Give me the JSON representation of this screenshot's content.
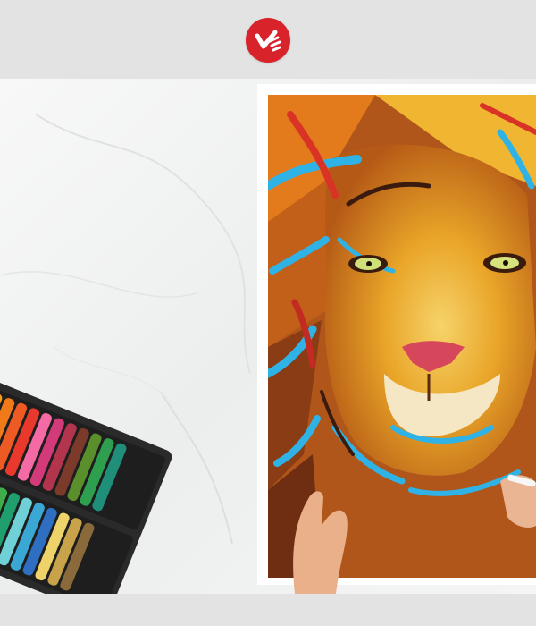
{
  "header": {
    "logo_icon": "brand-logo-icon",
    "logo_color": "#d8232a"
  },
  "photo": {
    "background_color": "#f2f3f3",
    "painting_frame_color": "#ffffff",
    "crayon_tray_color": "#2a2a2a",
    "crayon_colors": [
      "#f4c21e",
      "#f29a1b",
      "#f07a1a",
      "#ee5a24",
      "#e8392c",
      "#f36aa4",
      "#d23a7a",
      "#b2354d",
      "#7c3b2a",
      "#5a8f2c",
      "#2e9e4f",
      "#1f8f7a",
      "#3aa7d4",
      "#6fd0d6",
      "#e9e15a",
      "#f3f0c9"
    ]
  }
}
